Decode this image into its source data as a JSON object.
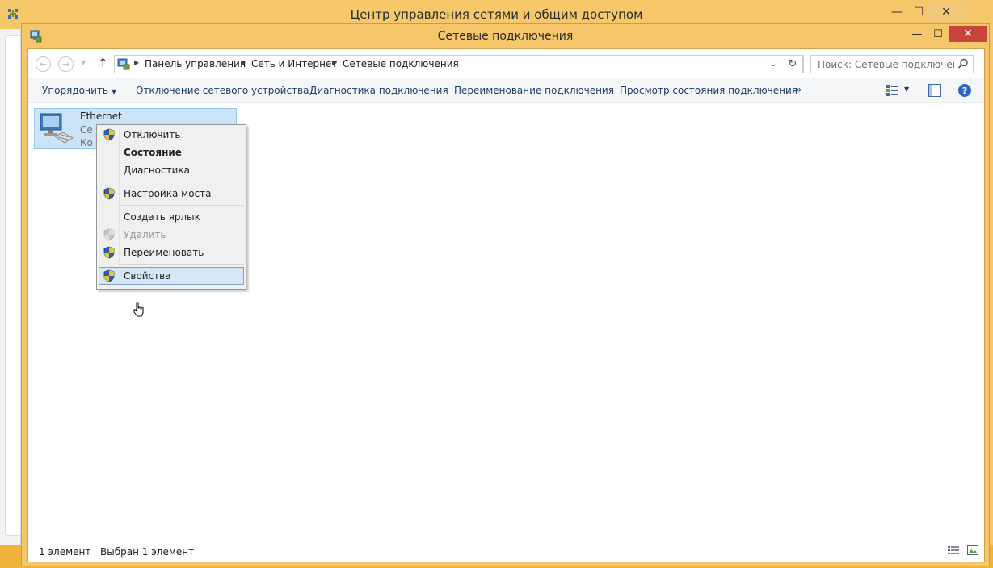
{
  "background_window": {
    "title": "Центр управления сетями и общим доступом"
  },
  "window": {
    "title": "Сетевые подключения"
  },
  "navigation": {
    "breadcrumbs": [
      "Панель управления",
      "Сеть и Интернет",
      "Сетевые подключения"
    ],
    "search_placeholder": "Поиск: Сетевые подключения"
  },
  "command_bar": {
    "organize": "Упорядочить",
    "disable_device": "Отключение сетевого устройства",
    "diagnose": "Диагностика подключения",
    "rename": "Переименование подключения",
    "view_status": "Просмотр состояния подключения",
    "more": "»"
  },
  "connection": {
    "name": "Ethernet",
    "line2": "Се",
    "line3": "Ко"
  },
  "context_menu": {
    "items": [
      {
        "label": "Отключить",
        "shield": true
      },
      {
        "label": "Состояние",
        "bold": true
      },
      {
        "label": "Диагностика"
      },
      {
        "label": "Настройка моста",
        "shield": true
      },
      {
        "label": "Создать ярлык"
      },
      {
        "label": "Удалить",
        "shield": true,
        "disabled": true
      },
      {
        "label": "Переименовать",
        "shield": true
      },
      {
        "label": "Свойства",
        "shield": true,
        "highlighted": true
      }
    ]
  },
  "status_bar": {
    "count": "1 элемент",
    "selected": "Выбран 1 элемент"
  },
  "colors": {
    "title_accent": "#f6c66a",
    "close_red": "#c7443a",
    "selection": "#cce4f7",
    "menu_highlight": "#d5e6f7"
  },
  "icons": {
    "app": "network-connections-icon",
    "shield": "uac-shield-icon",
    "search": "search-icon",
    "refresh": "refresh-icon",
    "help": "help-icon"
  }
}
